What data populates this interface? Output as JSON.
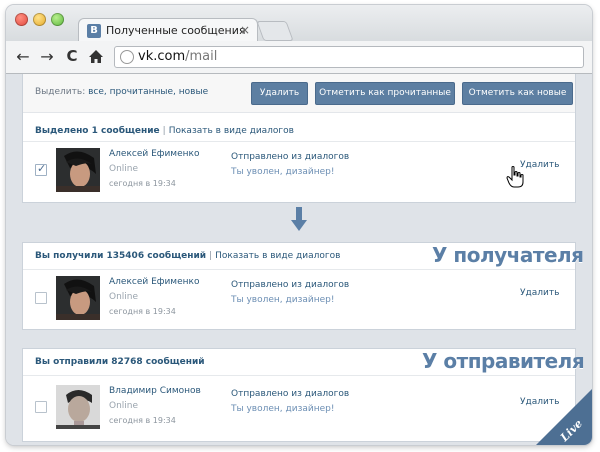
{
  "browser": {
    "tab_title": "Полученные сообщения",
    "tab_close": "×",
    "favicon": "В",
    "url_host": "vk.com",
    "url_path": "/mail",
    "back": "←",
    "forward": "→",
    "reload": "C"
  },
  "actionbar": {
    "select_label": "Выделить:",
    "select_links": "все, прочитанные, новые",
    "buttons": [
      {
        "label": "Удалить"
      },
      {
        "label": "Отметить как прочитанные"
      },
      {
        "label": "Отметить как новые"
      }
    ]
  },
  "selected": {
    "count_text": "Выделено 1 сообщение",
    "view_link": "Показать в виде диалогов",
    "message": {
      "name": "Алексей Ефименко",
      "status": "Online",
      "time": "сегодня в 19:34",
      "subject": "Отправлено из диалогов",
      "snippet": "Ты уволен, дизайнер!",
      "delete": "Удалить"
    }
  },
  "received": {
    "count_text": "Вы получили 135406 сообщений",
    "view_link": "Показать в виде диалогов",
    "caption": "У получателя",
    "message": {
      "name": "Алексей Ефименко",
      "status": "Online",
      "time": "сегодня в 19:34",
      "subject": "Отправлено из диалогов",
      "snippet": "Ты уволен, дизайнер!",
      "delete": "Удалить"
    }
  },
  "sent": {
    "count_text": "Вы отправили 82768 сообщений",
    "caption": "У отправителя",
    "message": {
      "name": "Владимир Симонов",
      "status": "Online",
      "time": "сегодня в 19:34",
      "subject": "Отправлено из диалогов",
      "snippet": "Ты уволен, дизайнер!",
      "delete": "Удалить"
    }
  },
  "badge": "Live",
  "colors": {
    "brand": "#5b7fa6",
    "link": "#2b587a",
    "button": "#5d7fa2"
  },
  "icons": [
    "back-arrow-icon",
    "forward-arrow-icon",
    "reload-icon",
    "home-icon",
    "globe-icon",
    "down-arrow-icon",
    "hand-cursor-icon",
    "checkmark-icon"
  ]
}
